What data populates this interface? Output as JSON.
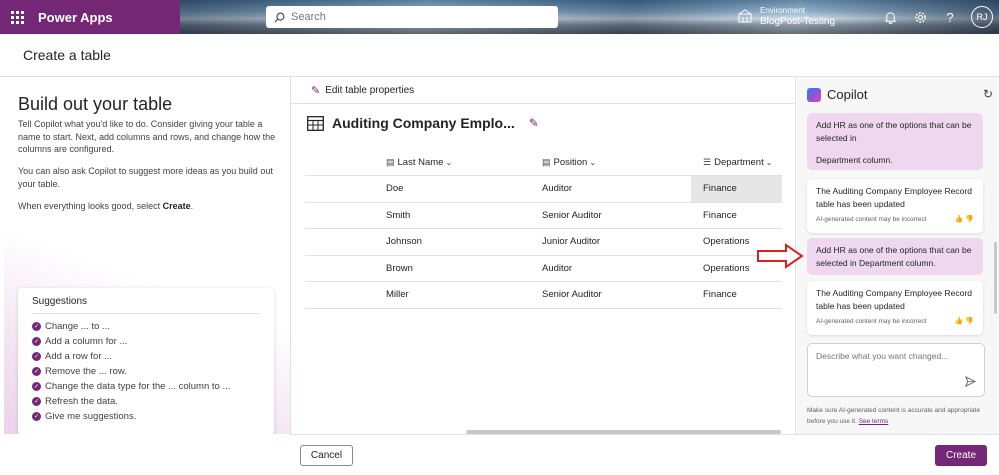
{
  "topbar": {
    "app_name": "Power Apps",
    "search_placeholder": "Search",
    "environment_label": "Environment",
    "environment_value": "BlogPost-Testing",
    "avatar_initials": "RJ",
    "icons": [
      "waffle-icon",
      "search-icon",
      "environment-icon",
      "bell-icon",
      "gear-icon",
      "help-icon"
    ]
  },
  "header": {
    "title": "Create a table"
  },
  "left": {
    "heading": "Build out your table",
    "desc1": "Tell Copilot what you'd like to do. Consider giving your table a name to start. Next, add columns and rows, and change how the columns are configured.",
    "desc2": "You can also ask Copilot to suggest more ideas as you build out your table.",
    "desc3_prefix": "When everything looks good, select ",
    "desc3_bold": "Create",
    "desc3_suffix": ".",
    "suggestions_title": "Suggestions",
    "suggestions": [
      "Change ... to ...",
      "Add a column for ...",
      "Add a row for ...",
      "Remove the ... row.",
      "Change the data type for the ... column to ...",
      "Refresh the data.",
      "Give me suggestions."
    ]
  },
  "middle": {
    "edit_props_label": "Edit table properties",
    "table_name": "Auditing Company Emplo...",
    "columns": [
      "Last Name",
      "Position",
      "Department"
    ],
    "rows": [
      [
        "Doe",
        "Auditor",
        "Finance"
      ],
      [
        "Smith",
        "Senior Auditor",
        "Finance"
      ],
      [
        "Johnson",
        "Junior Auditor",
        "Operations"
      ],
      [
        "Brown",
        "Auditor",
        "Operations"
      ],
      [
        "Miller",
        "Senior Auditor",
        "Finance"
      ]
    ]
  },
  "copilot": {
    "title": "Copilot",
    "msg1_line1": "Add HR as one of the options that can be selected in",
    "msg1_line2": "Department column.",
    "bot1": "The Auditing Company Employee Record table has been updated",
    "ai_note": "AI-generated content may be incorrect",
    "msg2": "Add HR as one of the options that can be selected in Department column.",
    "bot2": "The Auditing Company Employee Record table has been updated",
    "input_placeholder": "Describe what you want changed...",
    "disclaimer": "Make sure AI-generated content is accurate and appropriate before you use it.",
    "see_terms": "See terms"
  },
  "footer": {
    "cancel_label": "Cancel",
    "create_label": "Create"
  },
  "colors": {
    "brand": "#742774",
    "user_bubble": "#efd8ef",
    "arrow": "#e02020"
  }
}
